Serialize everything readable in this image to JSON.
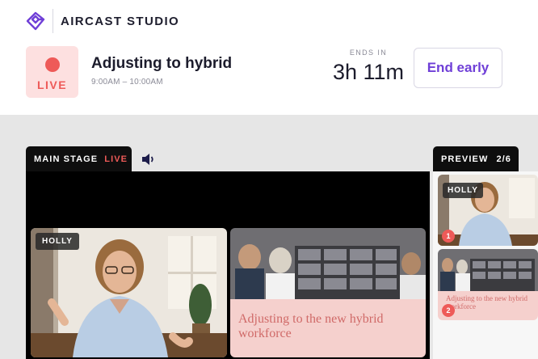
{
  "brand": {
    "name": "AIRCAST STUDIO",
    "logo_icon": "aircast-logo-icon",
    "accent_color": "#6f3fd7"
  },
  "session": {
    "live_badge": "LIVE",
    "title": "Adjusting to hybrid",
    "time_range": "9:00AM – 10:00AM",
    "ends_label": "ENDS IN",
    "ends_value": "3h 11m",
    "end_button": "End early",
    "live_color": "#ee5a58"
  },
  "main_stage": {
    "tab_label": "MAIN STAGE",
    "live_tag": "LIVE",
    "speaker_icon": "speaker-icon",
    "tiles": [
      {
        "type": "speaker",
        "name": "HOLLY"
      },
      {
        "type": "slide",
        "caption": "Adjusting to the new hybrid workforce"
      }
    ]
  },
  "preview": {
    "tab_label": "PREVIEW",
    "count": "2/6",
    "cards": [
      {
        "number": "1",
        "name": "HOLLY"
      },
      {
        "number": "2",
        "caption": "Adjusting to the new hybrid workforce"
      }
    ]
  }
}
